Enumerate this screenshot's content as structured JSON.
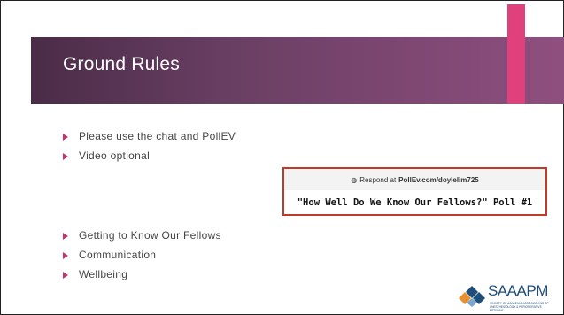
{
  "slide": {
    "title": "Ground Rules",
    "bullets_top": [
      "Please use the chat and PollEV",
      "Video optional"
    ],
    "bullets_bottom": [
      "Getting to Know Our Fellows",
      "Communication",
      "Wellbeing"
    ]
  },
  "poll": {
    "respond_prefix": "Respond at",
    "url": "PollEv.com/doylelim725",
    "question": "\"How Well Do We Know Our Fellows?\" Poll #1",
    "icon": "globe-icon"
  },
  "logo": {
    "name": "SAAAPM",
    "subtitle": "Society of Academic Associations of Anesthesiology & Perioperative Medicine",
    "icon": "diamond-logo-icon"
  },
  "colors": {
    "title_bar": "#6a3f64",
    "accent": "#e0407b",
    "bullet": "#c23573",
    "poll_border": "#c0392b",
    "logo_blue": "#1f4e79",
    "logo_orange": "#e8912d"
  }
}
